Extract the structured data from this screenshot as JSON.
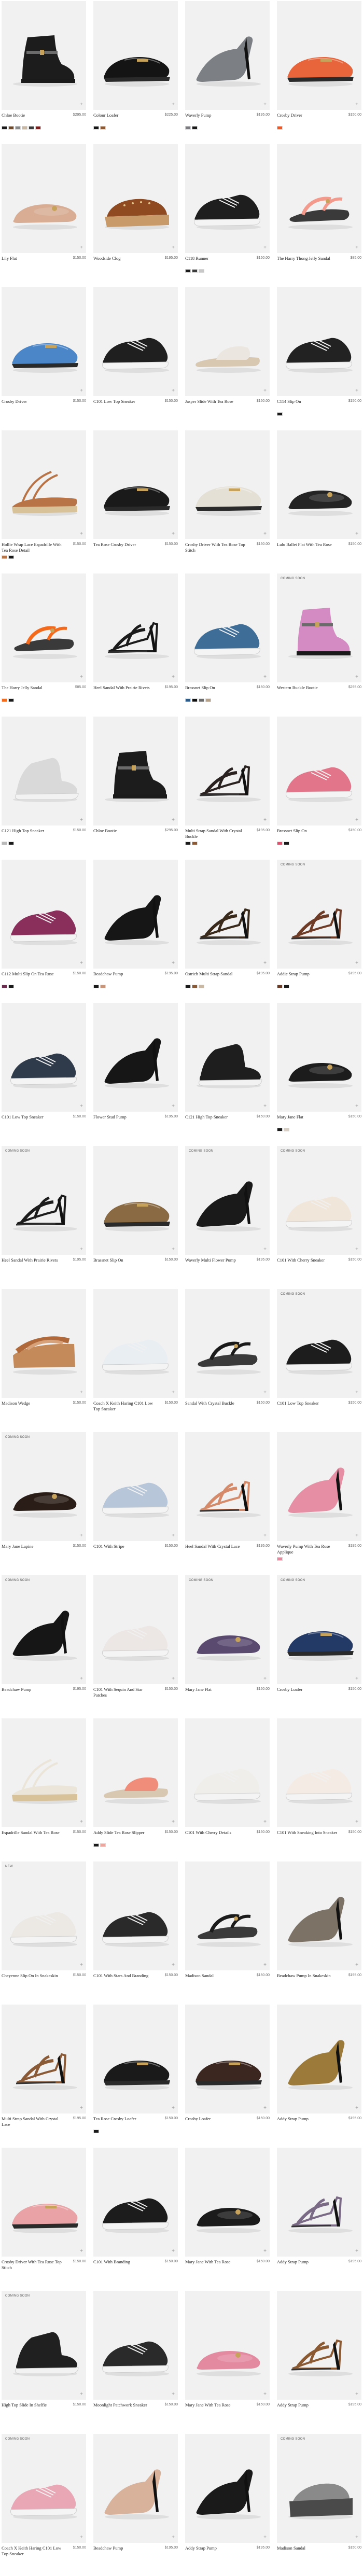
{
  "products": [
    {
      "name": "Chloe Bootie",
      "price": "$295.00",
      "badge": "",
      "swatches": [
        "#1b1b1b",
        "#6b4a2e",
        "#8a8a8a",
        "#c9b8a3",
        "#3a3a3a",
        "#7a1d1d"
      ],
      "shape": "bootie",
      "color": "#1c1c1c"
    },
    {
      "name": "Colour Loafer",
      "price": "$225.00",
      "badge": "",
      "swatches": [
        "#151515",
        "#8a5a36"
      ],
      "shape": "loafer",
      "color": "#141414"
    },
    {
      "name": "Waverly Pump",
      "price": "$195.00",
      "badge": "",
      "swatches": [
        "#7b7b80",
        "#1a1a1a"
      ],
      "shape": "pump",
      "color": "#7c7f84"
    },
    {
      "name": "Crosby Driver",
      "price": "$150.00",
      "badge": "",
      "swatches": [
        "#e85a2c"
      ],
      "shape": "loafer",
      "color": "#e8643a"
    },
    {
      "name": "Lily Flat",
      "price": "$150.00",
      "badge": "",
      "swatches": [],
      "shape": "flat",
      "color": "#d8ad93"
    },
    {
      "name": "Woodside Clog",
      "price": "$195.00",
      "badge": "",
      "swatches": [],
      "shape": "clog",
      "color": "#8f4a22"
    },
    {
      "name": "C118 Runner",
      "price": "$150.00",
      "badge": "",
      "swatches": [
        "#1a1a1a",
        "#3b3b3b",
        "#c8c8c8"
      ],
      "shape": "sneaker",
      "color": "#1e1e1e"
    },
    {
      "name": "The Harry Thong Jelly Sandal",
      "price": "$85.00",
      "badge": "",
      "swatches": [],
      "shape": "sandal",
      "color": "#f39a8c"
    },
    {
      "name": "Crosby Driver",
      "price": "$150.00",
      "badge": "",
      "swatches": [],
      "shape": "loafer",
      "color": "#4b86c9"
    },
    {
      "name": "C101 Low Top Sneaker",
      "price": "$150.00",
      "badge": "",
      "swatches": [],
      "shape": "sneaker",
      "color": "#1f1f1f"
    },
    {
      "name": "Jasper Slide With Tea Rose",
      "price": "$150.00",
      "badge": "",
      "swatches": [],
      "shape": "slide",
      "color": "#ebe7e0"
    },
    {
      "name": "C114 Slip On",
      "price": "$150.00",
      "badge": "",
      "swatches": [
        "#1a1a1a"
      ],
      "shape": "sneaker",
      "color": "#222222"
    },
    {
      "name": "Hollie Wrap Lace Espadrille With Tea Rose Detail",
      "price": "$150.00",
      "badge": "",
      "swatches": [
        "#b5764a",
        "#1a1a1a"
      ],
      "shape": "espadrille",
      "color": "#b87447"
    },
    {
      "name": "Tea Rose Crosby Driver",
      "price": "$150.00",
      "badge": "",
      "swatches": [],
      "shape": "loafer",
      "color": "#1a1a1a"
    },
    {
      "name": "Crosby Driver With Tea Rose Top Stitch",
      "price": "$150.00",
      "badge": "",
      "swatches": [],
      "shape": "loafer",
      "color": "#e4e0d6"
    },
    {
      "name": "Lulu Ballet Flat With Tea Rose",
      "price": "$150.00",
      "badge": "",
      "swatches": [],
      "shape": "flat",
      "color": "#242424"
    },
    {
      "name": "The Harry Jelly Sandal",
      "price": "$85.00",
      "badge": "",
      "swatches": [
        "#f36b1d",
        "#1a1a1a"
      ],
      "shape": "sandal",
      "color": "#f46a1c"
    },
    {
      "name": "Heel Sandal With Prairie Rivets",
      "price": "$195.00",
      "badge": "",
      "swatches": [],
      "shape": "heelsandal",
      "color": "#1b1b1b"
    },
    {
      "name": "Brassnet Slip On",
      "price": "$150.00",
      "badge": "",
      "swatches": [
        "#2d5b86",
        "#111111",
        "#6b6b6b",
        "#b5a08a"
      ],
      "shape": "sneaker",
      "color": "#3e6e98"
    },
    {
      "name": "Western Buckle Bootie",
      "price": "$295.00",
      "badge": "COMING SOON",
      "swatches": [],
      "shape": "bootie",
      "color": "#d48ac2"
    },
    {
      "name": "C121 High Top Sneaker",
      "price": "$150.00",
      "badge": "",
      "swatches": [
        "#b9b9b9",
        "#1a1a1a"
      ],
      "shape": "hightop",
      "color": "#d9d9d9"
    },
    {
      "name": "Chloe Bootie",
      "price": "$295.00",
      "badge": "",
      "swatches": [],
      "shape": "bootie",
      "color": "#1c1c1c"
    },
    {
      "name": "Multi Strap Sandal With Crystal Buckle",
      "price": "$195.00",
      "badge": "",
      "swatches": [
        "#1a1a1a",
        "#8a5a36"
      ],
      "shape": "heelsandal",
      "color": "#2a2220"
    },
    {
      "name": "Brassnet Slip On",
      "price": "$150.00",
      "badge": "",
      "swatches": [
        "#d9536f",
        "#1a1a1a"
      ],
      "shape": "sneaker",
      "color": "#e2758a"
    },
    {
      "name": "C112 Multi Slip On Tea Rose",
      "price": "$150.00",
      "badge": "",
      "swatches": [
        "#6a2c4f",
        "#1a1a1a"
      ],
      "shape": "sneaker",
      "color": "#8a2f5c"
    },
    {
      "name": "Beadchaw Pump",
      "price": "$195.00",
      "badge": "",
      "swatches": [
        "#1a1a1a",
        "#c7957a"
      ],
      "shape": "pump",
      "color": "#161616"
    },
    {
      "name": "Ostrich Multi Strap Sandal",
      "price": "$195.00",
      "badge": "",
      "swatches": [
        "#1a1a1a",
        "#8a5a36",
        "#c9b8a3"
      ],
      "shape": "heelsandal",
      "color": "#3a2a1c"
    },
    {
      "name": "Addie Strap Pump",
      "price": "$195.00",
      "badge": "COMING SOON",
      "swatches": [
        "#6b3a25",
        "#1a1a1a"
      ],
      "shape": "heelsandal",
      "color": "#6e3b26"
    },
    {
      "name": "C101 Low Top Sneaker",
      "price": "$150.00",
      "badge": "",
      "swatches": [],
      "shape": "sneaker",
      "color": "#2f3b4a"
    },
    {
      "name": "Flower Stud Pump",
      "price": "$195.00",
      "badge": "",
      "swatches": [],
      "shape": "pump",
      "color": "#161616"
    },
    {
      "name": "C121 High Top Sneaker",
      "price": "$150.00",
      "badge": "",
      "swatches": [],
      "shape": "hightop",
      "color": "#1e1e1e"
    },
    {
      "name": "Mary Jane Flat",
      "price": "$150.00",
      "badge": "",
      "swatches": [
        "#1a1a1a",
        "#d7cfc4"
      ],
      "shape": "flat",
      "color": "#1c1c1c"
    },
    {
      "name": "Heel Sandal With Prairie Rivets",
      "price": "$195.00",
      "badge": "COMING SOON",
      "swatches": [],
      "shape": "heelsandal",
      "color": "#1c1c1c"
    },
    {
      "name": "Brassnet Slip On",
      "price": "$150.00",
      "badge": "",
      "swatches": [],
      "shape": "loafer",
      "color": "#8a6a42"
    },
    {
      "name": "Waverly Multi Flower Pump",
      "price": "$195.00",
      "badge": "COMING SOON",
      "swatches": [],
      "shape": "pump",
      "color": "#1a1a1a"
    },
    {
      "name": "C101 With Cherry Sneaker",
      "price": "$150.00",
      "badge": "COMING SOON",
      "swatches": [],
      "shape": "sneaker",
      "color": "#f0e6da"
    },
    {
      "name": "Madison Wedge",
      "price": "$150.00",
      "badge": "",
      "swatches": [],
      "shape": "wedge",
      "color": "#b0693a"
    },
    {
      "name": "Coach X Keith Haring C101 Low Top Sneaker",
      "price": "$150.00",
      "badge": "",
      "swatches": [],
      "shape": "sneaker",
      "color": "#e9eef3"
    },
    {
      "name": "Sandal With Crystal Buckle",
      "price": "$150.00",
      "badge": "",
      "swatches": [],
      "shape": "sandal",
      "color": "#1a1a1a"
    },
    {
      "name": "C101 Low Top Sneaker",
      "price": "$150.00",
      "badge": "COMING SOON",
      "swatches": [],
      "shape": "sneaker",
      "color": "#1d1d1d"
    },
    {
      "name": "Mary Jane Lapine",
      "price": "$150.00",
      "badge": "COMING SOON",
      "swatches": [],
      "shape": "flat",
      "color": "#2a1c16"
    },
    {
      "name": "C101 With Stripe",
      "price": "$150.00",
      "badge": "",
      "swatches": [],
      "shape": "sneaker",
      "color": "#b7c7d9"
    },
    {
      "name": "Heel Sandal With Crystal Lace",
      "price": "$195.00",
      "badge": "",
      "swatches": [],
      "shape": "heelsandal",
      "color": "#d58a6a"
    },
    {
      "name": "Waverly Pump With Tea Rose Applique",
      "price": "$195.00",
      "badge": "",
      "swatches": [
        "#e48aa0"
      ],
      "shape": "pump",
      "color": "#e68ea3"
    },
    {
      "name": "Beadchaw Pump",
      "price": "$195.00",
      "badge": "COMING SOON",
      "swatches": [],
      "shape": "pump",
      "color": "#161616"
    },
    {
      "name": "C101 With Sequin And Star Patches",
      "price": "$150.00",
      "badge": "",
      "swatches": [],
      "shape": "sneaker",
      "color": "#ece7e4"
    },
    {
      "name": "Mary Jane Flat",
      "price": "$150.00",
      "badge": "COMING SOON",
      "swatches": [],
      "shape": "flat",
      "color": "#5a4a70"
    },
    {
      "name": "Crosby Loafer",
      "price": "$150.00",
      "badge": "COMING SOON",
      "swatches": [],
      "shape": "loafer",
      "color": "#243a66"
    },
    {
      "name": "Espadrille Sandal With Tea Rose",
      "price": "$150.00",
      "badge": "",
      "swatches": [],
      "shape": "espadrille",
      "color": "#ebe4d8"
    },
    {
      "name": "Addy Slide Tea Rose Slipper",
      "price": "$150.00",
      "badge": "",
      "swatches": [
        "#1a1a1a",
        "#e9a7a0"
      ],
      "shape": "slide",
      "color": "#ef8d7a"
    },
    {
      "name": "C101 With Cherry Details",
      "price": "$150.00",
      "badge": "",
      "swatches": [],
      "shape": "sneaker",
      "color": "#f0eeea"
    },
    {
      "name": "C101 With Sneaking Into Sneaker",
      "price": "$150.00",
      "badge": "",
      "swatches": [],
      "shape": "sneaker",
      "color": "#f4ece4"
    },
    {
      "name": "Cheyenne Slip On In Snakeskin",
      "price": "$150.00",
      "badge": "NEW",
      "swatches": [],
      "shape": "sneaker",
      "color": "#ece9e4"
    },
    {
      "name": "C101 With Stars And Branding",
      "price": "$150.00",
      "badge": "",
      "swatches": [],
      "shape": "sneaker",
      "color": "#2a2a2a"
    },
    {
      "name": "Madison Sandal",
      "price": "$150.00",
      "badge": "",
      "swatches": [],
      "shape": "sandal",
      "color": "#1b1b1b"
    },
    {
      "name": "Beadchaw Pump In Snakeskin",
      "price": "$195.00",
      "badge": "",
      "swatches": [],
      "shape": "pump",
      "color": "#7c7266"
    },
    {
      "name": "Multi Strap Sandal With Crystal Lace",
      "price": "$195.00",
      "badge": "",
      "swatches": [],
      "shape": "heelsandal",
      "color": "#8a5a36"
    },
    {
      "name": "Tea Rose Crosby Loafer",
      "price": "$150.00",
      "badge": "",
      "swatches": [
        "#1a1a1a"
      ],
      "shape": "loafer",
      "color": "#1a1a1a"
    },
    {
      "name": "Crosby Loafer",
      "price": "$150.00",
      "badge": "",
      "swatches": [],
      "shape": "loafer",
      "color": "#3b2620"
    },
    {
      "name": "Addy Strap Pump",
      "price": "$195.00",
      "badge": "",
      "swatches": [],
      "shape": "pump",
      "color": "#9c7a3a"
    },
    {
      "name": "Crosby Driver With Tea Rose Top Stitch",
      "price": "$150.00",
      "badge": "",
      "swatches": [],
      "shape": "loafer",
      "color": "#e9a3a6"
    },
    {
      "name": "C101 With Branding",
      "price": "$150.00",
      "badge": "",
      "swatches": [],
      "shape": "sneaker",
      "color": "#1c1c1c"
    },
    {
      "name": "Mary Jane With Tea Rose",
      "price": "$150.00",
      "badge": "",
      "swatches": [],
      "shape": "flat",
      "color": "#1b1b1b"
    },
    {
      "name": "Addy Strap Pump",
      "price": "$195.00",
      "badge": "",
      "swatches": [],
      "shape": "heelsandal",
      "color": "#7b6a85"
    },
    {
      "name": "High Top Slide In Shelfie",
      "price": "$150.00",
      "badge": "COMING SOON",
      "swatches": [],
      "shape": "hightop",
      "color": "#202020"
    },
    {
      "name": "Moonlight Patchwork Sneaker",
      "price": "$150.00",
      "badge": "",
      "swatches": [],
      "shape": "sneaker",
      "color": "#2a2a2a"
    },
    {
      "name": "Mary Jane With Tea Rose",
      "price": "$150.00",
      "badge": "",
      "swatches": [],
      "shape": "flat",
      "color": "#e48aa0"
    },
    {
      "name": "Addy Strap Pump",
      "price": "$195.00",
      "badge": "",
      "swatches": [],
      "shape": "heelsandal",
      "color": "#8b5a33"
    },
    {
      "name": "Coach X Keith Haring C101 Low Top Sneaker",
      "price": "$150.00",
      "badge": "COMING SOON",
      "swatches": [],
      "shape": "sneaker",
      "color": "#e9a7b6"
    },
    {
      "name": "Beadchaw Pump",
      "price": "$195.00",
      "badge": "",
      "swatches": [],
      "shape": "pump",
      "color": "#d9b29b"
    },
    {
      "name": "Addy Strap Pump",
      "price": "$195.00",
      "badge": "",
      "swatches": [],
      "shape": "pump",
      "color": "#1a1a1a"
    },
    {
      "name": "Madison Sandal",
      "price": "$150.00",
      "badge": "COMING SOON",
      "swatches": [],
      "shape": "platform",
      "color": "#8a8a8a"
    }
  ]
}
